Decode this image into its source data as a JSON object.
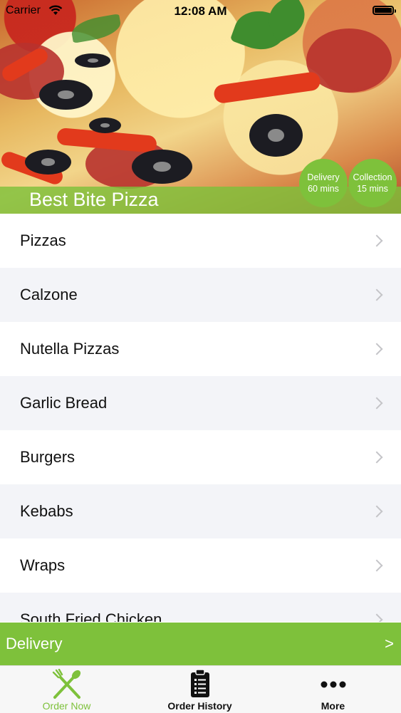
{
  "status_bar": {
    "carrier": "Carrier",
    "time": "12:08 AM"
  },
  "store": {
    "name": "Best Bite Pizza",
    "delivery_label": "Delivery",
    "delivery_time": "60 mins",
    "collection_label": "Collection",
    "collection_time": "15 mins"
  },
  "menu": {
    "items": [
      {
        "label": "Pizzas"
      },
      {
        "label": "Calzone"
      },
      {
        "label": "Nutella Pizzas"
      },
      {
        "label": "Garlic Bread"
      },
      {
        "label": "Burgers"
      },
      {
        "label": "Kebabs"
      },
      {
        "label": "Wraps"
      },
      {
        "label": "South Fried Chicken"
      }
    ]
  },
  "delivery_bar": {
    "label": "Delivery",
    "arrow": ">"
  },
  "tabs": [
    {
      "label": "Order Now",
      "icon": "fork-knife-icon",
      "active": true
    },
    {
      "label": "Order History",
      "icon": "clipboard-list-icon",
      "active": false
    },
    {
      "label": "More",
      "icon": "more-dots-icon",
      "active": false
    }
  ],
  "colors": {
    "accent": "#7ec13b",
    "row_alt": "#f3f4f8"
  }
}
